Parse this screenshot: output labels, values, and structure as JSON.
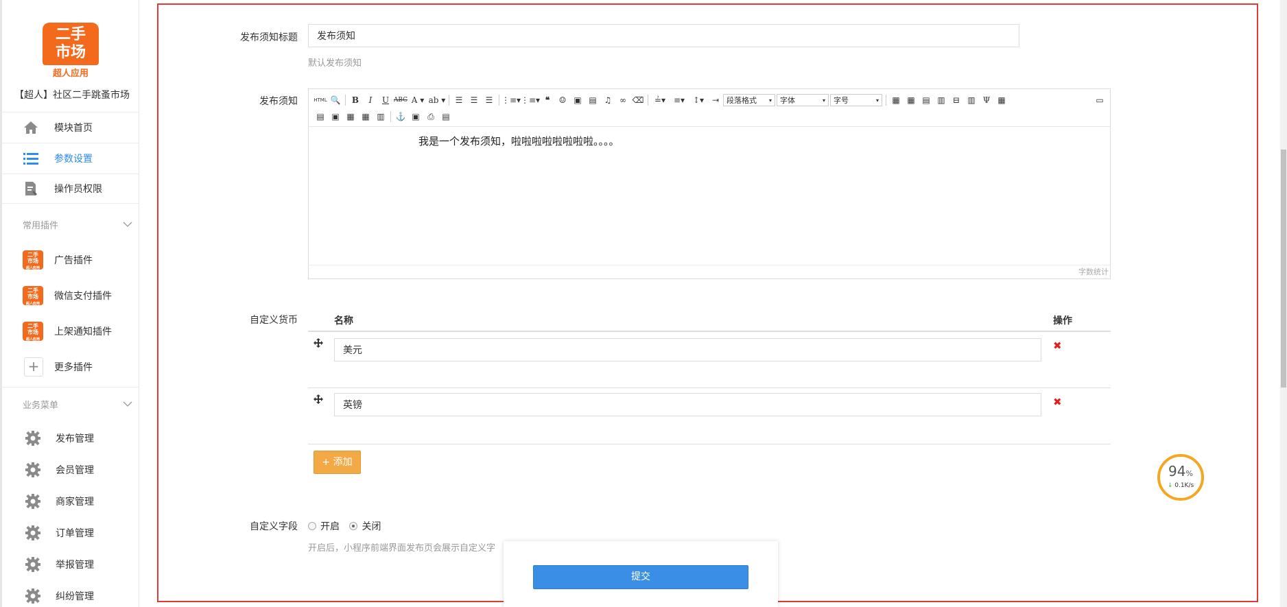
{
  "sidebar": {
    "logo_line1": "二手",
    "logo_line2": "市场",
    "logo_sub": "超人应用",
    "app_name": "【超人】社区二手跳蚤市场",
    "nav": [
      {
        "label": "模块首页",
        "icon": "home-icon"
      },
      {
        "label": "参数设置",
        "icon": "list-icon",
        "active": true
      },
      {
        "label": "操作员权限",
        "icon": "document-edit-icon"
      }
    ],
    "plugins_title": "常用插件",
    "plugins": [
      {
        "label": "广告插件"
      },
      {
        "label": "微信支付插件"
      },
      {
        "label": "上架通知插件"
      }
    ],
    "more_plugins": "更多插件",
    "business_title": "业务菜单",
    "business": [
      {
        "label": "发布管理"
      },
      {
        "label": "会员管理"
      },
      {
        "label": "商家管理"
      },
      {
        "label": "订单管理"
      },
      {
        "label": "举报管理"
      },
      {
        "label": "纠纷管理"
      }
    ]
  },
  "form": {
    "notice_title_label": "发布须知标题",
    "notice_title_value": "发布须知",
    "notice_title_help": "默认发布须知",
    "notice_label": "发布须知",
    "editor": {
      "html_btn": "HTML",
      "paragraph_select": "段落格式",
      "font_select": "字体",
      "size_select": "字号",
      "content": "我是一个发布须知，啦啦啦啦啦啦啦啦。。。。",
      "word_count": "字数统计"
    },
    "currency_label": "自定义货币",
    "currency_table": {
      "col_name": "名称",
      "col_action": "操作",
      "rows": [
        {
          "value": "美元"
        },
        {
          "value": "英镑"
        }
      ]
    },
    "add_button": "+ 添加",
    "custom_field_label": "自定义字段",
    "radio_on": "开启",
    "radio_off": "关闭",
    "custom_field_help": "开启后，小程序前端界面发布页会展示自定义字",
    "submit": "提交"
  },
  "speed_widget": {
    "percent": "94",
    "unit": "%",
    "net": "0.1K/s"
  },
  "colors": {
    "brand_orange": "#f46a1c",
    "active_blue": "#2d8cf0",
    "frame_red": "#e53935",
    "submit_blue": "#3a8ee6",
    "add_orange": "#f3a945"
  }
}
